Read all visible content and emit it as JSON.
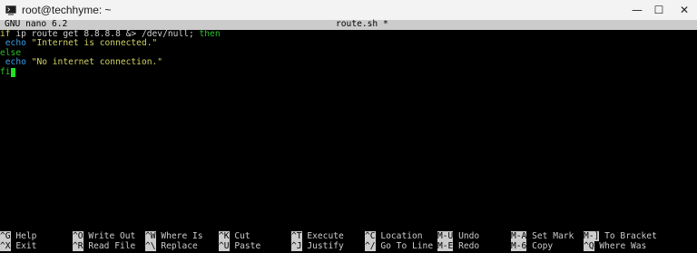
{
  "window": {
    "title": "root@techhyme: ~",
    "minimize_icon": "minimize-icon",
    "maximize_icon": "maximize-icon",
    "close_icon": "close-icon",
    "minimize_glyph": "—",
    "maximize_glyph": "☐",
    "close_glyph": "✕"
  },
  "nano": {
    "version": "GNU nano 6.2",
    "filename": "route.sh *"
  },
  "editor": {
    "line1": {
      "kw": "if",
      "text": " ip route get 8.8.8.8 &> /dev/null; ",
      "then": "then"
    },
    "line2": {
      "indent": " ",
      "kw": "echo",
      "str": " \"Internet is connected.\""
    },
    "line3": {
      "kw": "else"
    },
    "line4": {
      "indent": " ",
      "kw": "echo",
      "str": " \"No internet connection.\""
    },
    "line5": {
      "kw": "fi"
    }
  },
  "shortcuts": [
    {
      "key": "^G",
      "label": " Help"
    },
    {
      "key": "^O",
      "label": " Write Out"
    },
    {
      "key": "^W",
      "label": " Where Is"
    },
    {
      "key": "^K",
      "label": " Cut"
    },
    {
      "key": "^T",
      "label": " Execute"
    },
    {
      "key": "^C",
      "label": " Location"
    },
    {
      "key": "M-U",
      "label": " Undo"
    },
    {
      "key": "M-A",
      "label": " Set Mark"
    },
    {
      "key": "M-]",
      "label": " To Bracket"
    },
    {
      "key": "^X",
      "label": " Exit"
    },
    {
      "key": "^R",
      "label": " Read File"
    },
    {
      "key": "^\\",
      "label": " Replace"
    },
    {
      "key": "^U",
      "label": " Paste"
    },
    {
      "key": "^J",
      "label": " Justify"
    },
    {
      "key": "^/",
      "label": " Go To Line"
    },
    {
      "key": "M-E",
      "label": " Redo"
    },
    {
      "key": "M-6",
      "label": " Copy"
    },
    {
      "key": "^Q",
      "label": " Where Was"
    }
  ]
}
